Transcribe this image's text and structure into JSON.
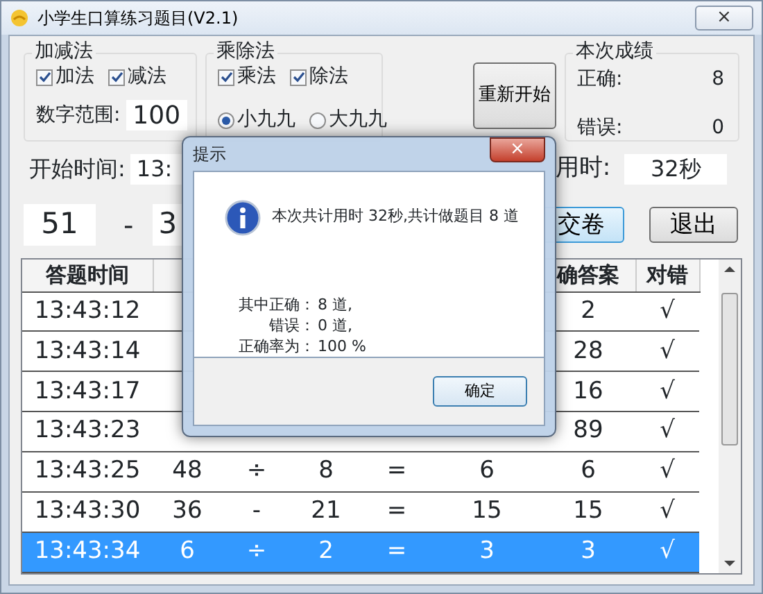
{
  "window": {
    "title": "小学生口算练习题目(V2.1)",
    "close": "×"
  },
  "add_sub": {
    "title": "加减法",
    "options": [
      {
        "label": "加法",
        "checked": true
      },
      {
        "label": "减法",
        "checked": true
      }
    ],
    "range_label": "数字范围:",
    "range_value": "100"
  },
  "mul_div": {
    "title": "乘除法",
    "options": [
      {
        "label": "乘法",
        "checked": true
      },
      {
        "label": "除法",
        "checked": true
      }
    ],
    "tables": [
      {
        "label": "小九九",
        "selected": true
      },
      {
        "label": "大九九",
        "selected": false
      }
    ]
  },
  "restart_button": "重新开始",
  "score": {
    "title": "本次成绩",
    "rows": [
      {
        "label": "正确:",
        "value": "8"
      },
      {
        "label": "错误:",
        "value": "0"
      }
    ]
  },
  "start_time": {
    "label": "开始时间:",
    "value": "13:"
  },
  "elapsed": {
    "label": "用时:",
    "value": "32秒"
  },
  "question": {
    "operand_1": "51",
    "operator": "-",
    "operand_2": "3"
  },
  "submit_button": "交卷",
  "exit_button": "退出",
  "table": {
    "columns": [
      "答题时间",
      null,
      null,
      null,
      null,
      null,
      "确答案",
      "对错"
    ],
    "rows": [
      {
        "selected": false,
        "cells": [
          "13:43:12",
          null,
          null,
          null,
          null,
          null,
          "2",
          "√"
        ]
      },
      {
        "selected": false,
        "cells": [
          "13:43:14",
          null,
          null,
          null,
          null,
          null,
          "28",
          "√"
        ]
      },
      {
        "selected": false,
        "cells": [
          "13:43:17",
          null,
          null,
          null,
          null,
          null,
          "16",
          "√"
        ]
      },
      {
        "selected": false,
        "cells": [
          "13:43:23",
          null,
          null,
          null,
          null,
          null,
          "89",
          "√"
        ]
      },
      {
        "selected": false,
        "cells": [
          "13:43:25",
          "48",
          "÷",
          "8",
          "=",
          "6",
          "6",
          "√"
        ]
      },
      {
        "selected": false,
        "cells": [
          "13:43:30",
          "36",
          "-",
          "21",
          "=",
          "15",
          "15",
          "√"
        ]
      },
      {
        "selected": true,
        "cells": [
          "13:43:34",
          "6",
          "÷",
          "2",
          "=",
          "3",
          "3",
          "√"
        ]
      }
    ]
  },
  "dialog": {
    "title": "提示",
    "close": "×",
    "message": "本次共计用时 32秒,共计做题目 8 道",
    "details": [
      {
        "label": "其中正确：",
        "value": "8 道,"
      },
      {
        "label": "错误：",
        "value": "0 道,"
      },
      {
        "label": "正确率为：",
        "value": "100 %"
      }
    ],
    "ok_button": "确定"
  }
}
